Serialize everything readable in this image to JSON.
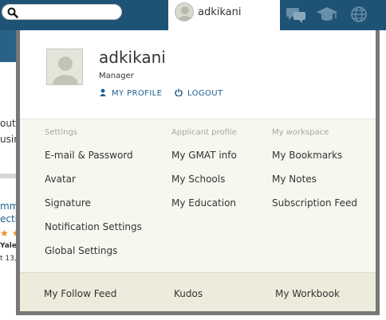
{
  "header": {
    "search": {
      "value": "",
      "placeholder": ""
    },
    "user_tab": {
      "name": "adkikani"
    },
    "icons": [
      "chat-icon",
      "graduation-cap-icon",
      "globe-icon"
    ]
  },
  "background": {
    "lines": [
      "out",
      "usin"
    ],
    "links": [
      "mmi",
      "ecti"
    ],
    "stars": "★ ★",
    "small": [
      "Yale",
      "t 13,"
    ]
  },
  "profile": {
    "username": "adkikani",
    "role": "Manager",
    "links": {
      "my_profile": "MY PROFILE",
      "logout": "LOGOUT"
    }
  },
  "menus": {
    "settings": {
      "heading": "Settings",
      "items": [
        "E-mail & Password",
        "Avatar",
        "Signature",
        "Notification Settings",
        "Global Settings"
      ]
    },
    "applicant_profile": {
      "heading": "Applicant profile",
      "items": [
        "My GMAT info",
        "My Schools",
        "My Education"
      ]
    },
    "workspace": {
      "heading": "My workspace",
      "items": [
        "My Bookmarks",
        "My Notes",
        "Subscription Feed"
      ]
    }
  },
  "footer": {
    "follow_feed": "My Follow Feed",
    "kudos": "Kudos",
    "workbook": "My Workbook"
  },
  "colors": {
    "header_bg": "#1f5375",
    "link": "#1a5f8f",
    "menu_bg": "#f7f7ef",
    "footer_bg": "#ecebdc",
    "frame": "#777777"
  }
}
